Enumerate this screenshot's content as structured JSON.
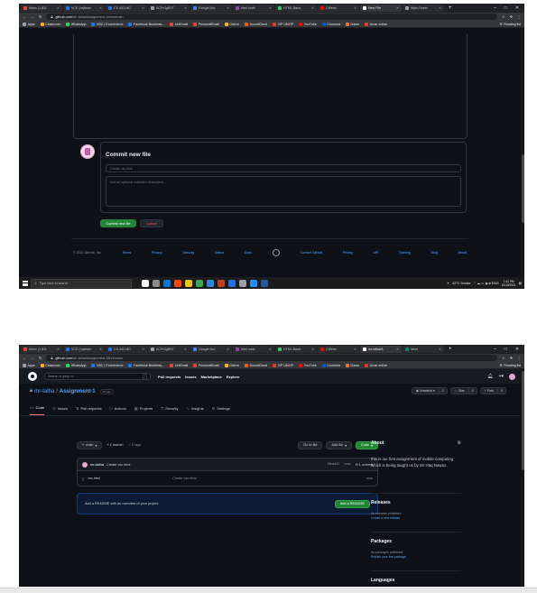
{
  "screens": [
    {
      "tabs": [
        {
          "label": "Inbox (1,811",
          "color": "#ea4335"
        },
        {
          "label": "VCE (mylearn",
          "color": "#1a73e8"
        },
        {
          "label": "CS-443-MC",
          "color": "#1a73e8"
        },
        {
          "label": "ACFrOgB07",
          "color": "#9aa0a6"
        },
        {
          "label": "Google Acc",
          "color": "#4285f4"
        },
        {
          "label": "html code",
          "color": "#8e44ad"
        },
        {
          "label": "HTML Basic",
          "color": "#2ecc71"
        },
        {
          "label": "CWebo",
          "color": "#ff0000"
        },
        {
          "label": "New File",
          "color": "#ffffff",
          "active": true
        },
        {
          "label": "https://meet",
          "color": "#9aa0a6"
        }
      ],
      "url": {
        "host": "github.com",
        "path": "/mr-talha/Assignment-1/new/main"
      }
    },
    {
      "tabs": [
        {
          "label": "Inbox (1,811",
          "color": "#ea4335"
        },
        {
          "label": "VCE (mylearn",
          "color": "#1a73e8"
        },
        {
          "label": "CS-443-MC",
          "color": "#1a73e8"
        },
        {
          "label": "ACFrOgB07",
          "color": "#9aa0a6"
        },
        {
          "label": "Google Acc",
          "color": "#4285f4"
        },
        {
          "label": "html code",
          "color": "#8e44ad"
        },
        {
          "label": "HTML Basic",
          "color": "#2ecc71"
        },
        {
          "label": "CWebo",
          "color": "#ff0000"
        },
        {
          "label": "mr-talha/A",
          "color": "#ffffff",
          "active": true
        },
        {
          "label": "Meet",
          "color": "#00897b"
        }
      ],
      "url": {
        "host": "github.com",
        "path": "/mr-talha/Assignment-1/tree/main"
      }
    }
  ],
  "bookmarks": [
    {
      "label": "Apps",
      "color": "#9aa0a6"
    },
    {
      "label": "Classroom",
      "color": "#f9ab00"
    },
    {
      "label": "WhatsApp",
      "color": "#25d366"
    },
    {
      "label": "VBC | Ecommerce",
      "color": "#1a73e8"
    },
    {
      "label": "Facebook Business...",
      "color": "#1877f2"
    },
    {
      "label": "UniEmail",
      "color": "#ea4335"
    },
    {
      "label": "PersonalEmail",
      "color": "#ea4335"
    },
    {
      "label": "Gdrive",
      "color": "#fbbc04"
    },
    {
      "label": "SoundCloud",
      "color": "#ff5500"
    },
    {
      "label": "ZIP UNZIP",
      "color": "#e53935"
    },
    {
      "label": "YouTube",
      "color": "#ff0000"
    },
    {
      "label": "Coursera",
      "color": "#0056d2"
    },
    {
      "label": "Daraz",
      "color": "#f57224"
    },
    {
      "label": "Umar online",
      "color": "#e53935"
    }
  ],
  "reading_list": "Reading list",
  "commit_form": {
    "title": "Commit new file",
    "summary_placeholder": "Create vsc.html",
    "description_placeholder": "Add an optional extended description...",
    "commit_button": "Commit new file",
    "cancel_button": "Cancel"
  },
  "footer": {
    "copyright": "© 2021 GitHub, Inc.",
    "left_links": [
      "Terms",
      "Privacy",
      "Security",
      "Status",
      "Docs"
    ],
    "right_links": [
      "Contact GitHub",
      "Pricing",
      "API",
      "Training",
      "Blog",
      "About"
    ]
  },
  "taskbar": {
    "search_placeholder": "Type here to search",
    "weather": "32°C  Smoke",
    "time": "7:41 PM",
    "date": "10/10/2021",
    "app_colors": [
      "#ffffff",
      "#8a8a8a",
      "#0078d4",
      "#ff4500",
      "#f2c300",
      "#3aa757",
      "#2b88d8",
      "#c43e1c",
      "#1f6feb",
      "#9aa0a6",
      "#1e90ff",
      "#2b579a"
    ]
  },
  "github": {
    "search_placeholder": "Search or jump to...",
    "search_key": "/",
    "nav": [
      "Pull requests",
      "Issues",
      "Marketplace",
      "Explore"
    ],
    "owner": "mr-talha",
    "repo": "Assignment-1",
    "visibility": "Private",
    "actions": [
      {
        "label": "Unwatch",
        "count": "1"
      },
      {
        "label": "Star",
        "count": "0"
      },
      {
        "label": "Fork",
        "count": "0"
      }
    ],
    "tabs": [
      {
        "label": "Code",
        "icon": "<>",
        "active": true
      },
      {
        "label": "Issues",
        "icon": "⊙"
      },
      {
        "label": "Pull requests",
        "icon": "⇅"
      },
      {
        "label": "Actions",
        "icon": "▷"
      },
      {
        "label": "Projects",
        "icon": "▦"
      },
      {
        "label": "Security",
        "icon": "⛉"
      },
      {
        "label": "Insights",
        "icon": "∿"
      },
      {
        "label": "Settings",
        "icon": "⚙"
      }
    ],
    "branch": "main",
    "branch_count": "1 branch",
    "tag_count": "0 tags",
    "go_to_file": "Go to file",
    "add_file": "Add file",
    "code_button": "Code",
    "last_commit": {
      "author": "mr-talha",
      "message": "Create vsc.html",
      "hash": "6feda41",
      "age": "now",
      "commits": "1 commit"
    },
    "files": [
      {
        "name": "vsc.html",
        "message": "Create vsc.html",
        "age": "now"
      }
    ],
    "readme_prompt": "Add a README with an overview of your project.",
    "readme_button": "Add a README",
    "about_title": "About",
    "about_text": "this is our first assignment of mobile computing which is being taught us by Sir Haq Nawaz.",
    "releases": {
      "title": "Releases",
      "note": "No releases published",
      "link": "Create a new release"
    },
    "packages": {
      "title": "Packages",
      "note": "No packages published",
      "link": "Publish your first package"
    },
    "languages_title": "Languages"
  }
}
